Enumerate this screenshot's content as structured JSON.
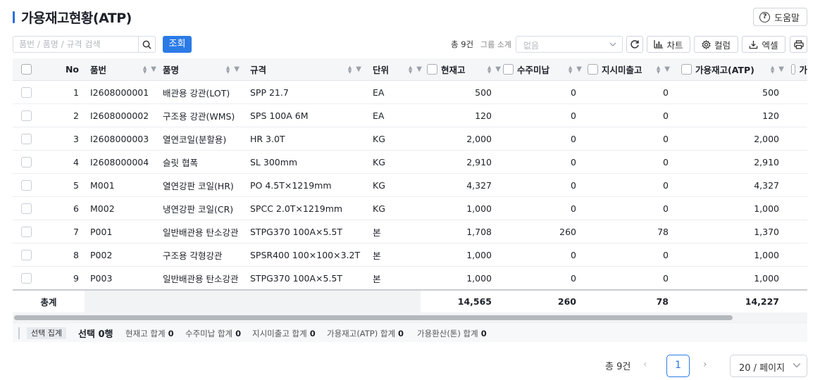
{
  "page": {
    "title": "가용재고현황(ATP)",
    "help_label": "도움말"
  },
  "toolbar": {
    "search_placeholder": "품번 / 품명 / 규격 검색",
    "query_label": "조회",
    "total_label": "총 9건",
    "group_label": "그룹 소계",
    "group_value": "없음",
    "chart_label": "차트",
    "columns_label": "컬럼",
    "excel_label": "엑셀"
  },
  "table": {
    "headers": {
      "no": "No",
      "code": "품번",
      "name": "품명",
      "spec": "규격",
      "unit": "단위",
      "current": "현재고",
      "order": "수주미납",
      "undelivered": "지시미출고",
      "atp": "가용재고(ATP)",
      "extra": "가"
    },
    "rows": [
      {
        "no": "1",
        "code": "I2608000001",
        "name": "배관용 강관(LOT)",
        "spec": "SPP 21.7",
        "unit": "EA",
        "current": "500",
        "order": "0",
        "undelivered": "0",
        "atp": "500"
      },
      {
        "no": "2",
        "code": "I2608000002",
        "name": "구조용 강관(WMS)",
        "spec": "SPS 100A 6M",
        "unit": "EA",
        "current": "120",
        "order": "0",
        "undelivered": "0",
        "atp": "120"
      },
      {
        "no": "3",
        "code": "I2608000003",
        "name": "열연코일(분할용)",
        "spec": "HR 3.0T",
        "unit": "KG",
        "current": "2,000",
        "order": "0",
        "undelivered": "0",
        "atp": "2,000"
      },
      {
        "no": "4",
        "code": "I2608000004",
        "name": "슬릿 협폭",
        "spec": "SL 300mm",
        "unit": "KG",
        "current": "2,910",
        "order": "0",
        "undelivered": "0",
        "atp": "2,910"
      },
      {
        "no": "5",
        "code": "M001",
        "name": "열연강판 코일(HR)",
        "spec": "PO 4.5T×1219mm",
        "unit": "KG",
        "current": "4,327",
        "order": "0",
        "undelivered": "0",
        "atp": "4,327"
      },
      {
        "no": "6",
        "code": "M002",
        "name": "냉연강판 코일(CR)",
        "spec": "SPCC 2.0T×1219mm",
        "unit": "KG",
        "current": "1,000",
        "order": "0",
        "undelivered": "0",
        "atp": "1,000"
      },
      {
        "no": "7",
        "code": "P001",
        "name": "일반배관용 탄소강관",
        "spec": "STPG370 100A×5.5T",
        "unit": "본",
        "current": "1,708",
        "order": "260",
        "undelivered": "78",
        "atp": "1,370"
      },
      {
        "no": "8",
        "code": "P002",
        "name": "구조용 각형강관",
        "spec": "SPSR400 100×100×3.2T",
        "unit": "본",
        "current": "1,000",
        "order": "0",
        "undelivered": "0",
        "atp": "1,000"
      },
      {
        "no": "9",
        "code": "P003",
        "name": "일반배관용 탄소강관",
        "spec": "STPG370 100A×5.5T",
        "unit": "본",
        "current": "1,000",
        "order": "0",
        "undelivered": "0",
        "atp": "1,000"
      }
    ],
    "summary": {
      "label": "총계",
      "current": "14,565",
      "order": "260",
      "undelivered": "78",
      "atp": "14,227"
    }
  },
  "selection": {
    "tag": "선택 집계",
    "count": "선택 0행",
    "items": [
      {
        "label": "현재고 합계",
        "value": "0"
      },
      {
        "label": "수주미납 합계",
        "value": "0"
      },
      {
        "label": "지시미출고 합계",
        "value": "0"
      },
      {
        "label": "가용재고(ATP) 합계",
        "value": "0"
      },
      {
        "label": "가용환산(톤) 합계",
        "value": "0"
      }
    ]
  },
  "pagination": {
    "total": "총 9건",
    "current_page": "1",
    "page_size": "20 / 페이지"
  },
  "colors": {
    "accent": "#2b7be6",
    "title_bar": "#2b6fe0"
  }
}
